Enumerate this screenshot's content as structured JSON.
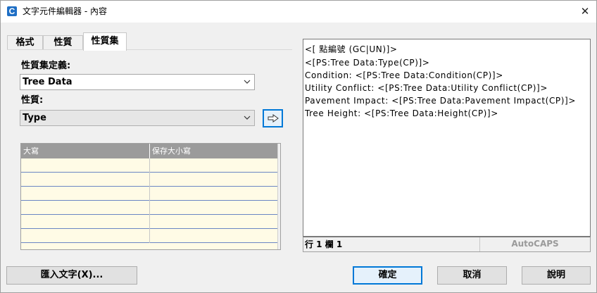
{
  "window": {
    "title": "文字元件編輯器 - 內容",
    "app_icon_letter": "C",
    "close_glyph": "✕"
  },
  "tabs": [
    {
      "label": "格式",
      "active": false
    },
    {
      "label": "性質",
      "active": false
    },
    {
      "label": "性質集",
      "active": true
    }
  ],
  "property_set": {
    "definition_label": "性質集定義:",
    "definition_value": "Tree Data",
    "property_label": "性質:",
    "property_value": "Type",
    "insert_button_icon": "arrow-right-icon"
  },
  "grid": {
    "columns": [
      "大寫",
      "保存大小寫"
    ],
    "row_count": 6
  },
  "editor": {
    "lines": [
      "<[ 點編號 (GC|UN)]>",
      "<[PS:Tree Data:Type(CP)]>",
      "Condition: <[PS:Tree Data:Condition(CP)]>",
      "Utility Conflict: <[PS:Tree Data:Utility Conflict(CP)]>",
      "Pavement Impact: <[PS:Tree Data:Pavement Impact(CP)]>",
      "Tree Height: <[PS:Tree Data:Height(CP)]>"
    ],
    "status_position": "行 1 欄 1",
    "status_caps": "AutoCAPS"
  },
  "buttons": {
    "import_text": "匯入文字(X)...",
    "ok": "確定",
    "cancel": "取消",
    "help": "說明"
  },
  "colors": {
    "accent": "#0078d7",
    "grid_header": "#9b9b9b",
    "grid_body": "#fffbe6",
    "grid_row_line": "#6a86c4"
  }
}
